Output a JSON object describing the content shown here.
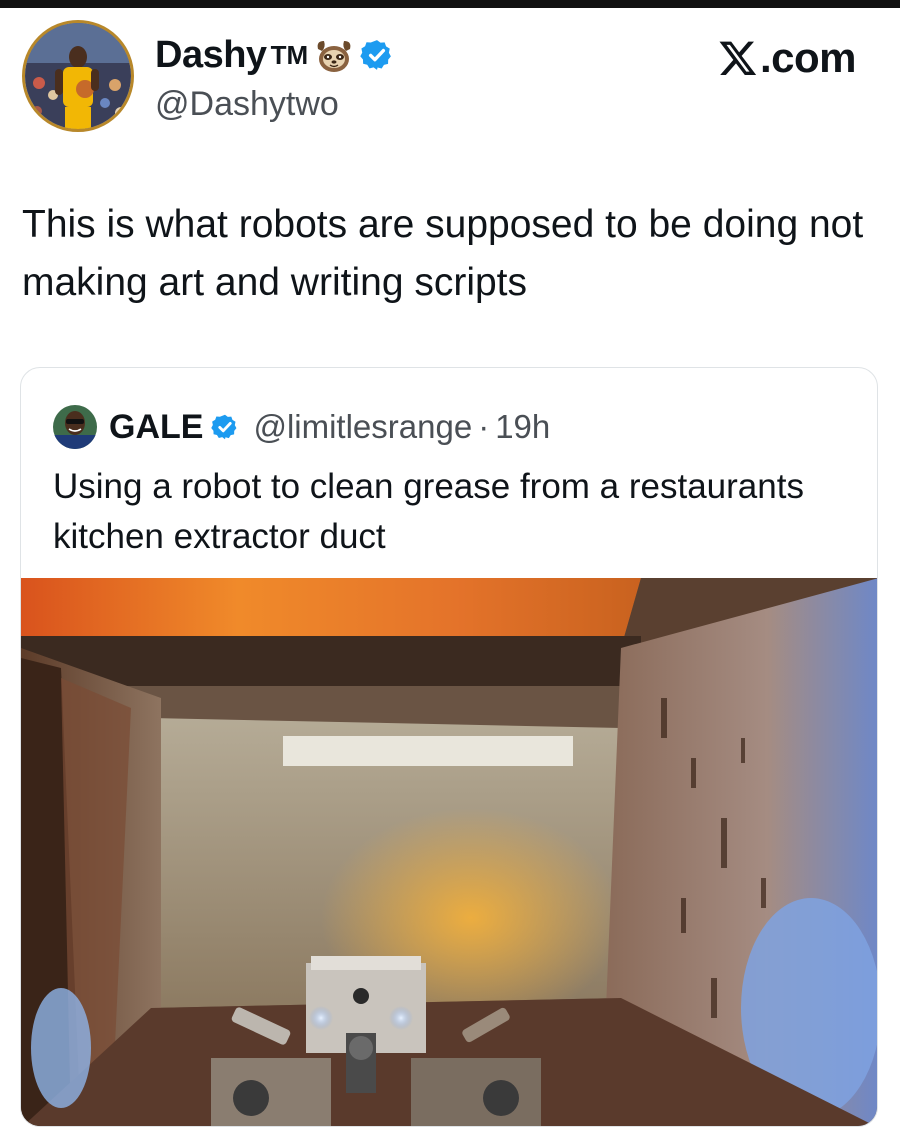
{
  "tweet": {
    "display_name": "Dashy",
    "tm": "TM",
    "handle": "@Dashytwo",
    "text": "This is what robots are supposed to be doing not making art and writing scripts",
    "avatar_icon": "avatar-basketball-player",
    "emoji_icon": "sloth-icon",
    "verified_icon": "verified-badge-icon"
  },
  "brand": {
    "text": ".com",
    "logo_icon": "x-logo-icon"
  },
  "quote": {
    "display_name": "GALE",
    "handle": "@limitlesrange",
    "separator": "·",
    "time": "19h",
    "text": "Using a robot to clean grease from a restaurants kitchen extractor duct",
    "media_icon": "video-still-duct-robot"
  },
  "colors": {
    "verified_blue": "#1d9bf0",
    "text_primary": "#0f1419",
    "text_secondary": "#4a4f55",
    "border": "#dfe3e6"
  }
}
